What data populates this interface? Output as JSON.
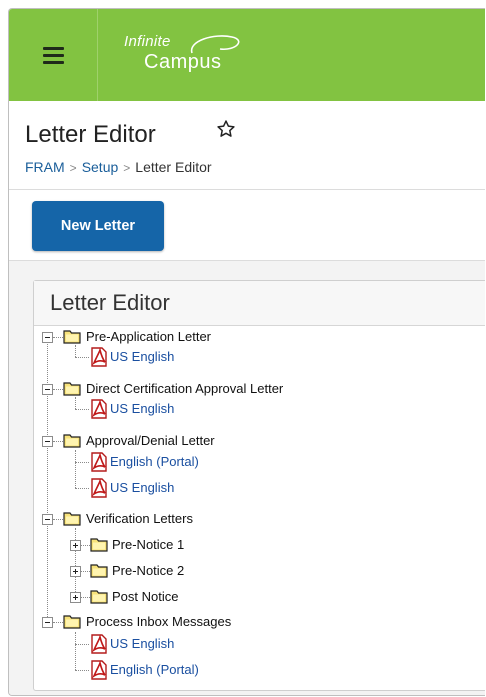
{
  "app": {
    "logo_line1": "Infinite",
    "logo_line2": "Campus",
    "brand_color": "#82c341",
    "primary_button_color": "#1565a8",
    "link_color": "#1a4fa0"
  },
  "page": {
    "title": "Letter Editor",
    "breadcrumb": [
      "FRAM",
      "Setup",
      "Letter Editor"
    ]
  },
  "toolbar": {
    "new_letter_label": "New Letter"
  },
  "panel": {
    "title": "Letter Editor"
  },
  "tree": {
    "pre_application": {
      "label": "Pre-Application Letter",
      "children": [
        "US English"
      ]
    },
    "direct_cert": {
      "label": "Direct Certification Approval Letter",
      "children": [
        "US English"
      ]
    },
    "approval_denial": {
      "label": "Approval/Denial Letter",
      "children": [
        "English (Portal)",
        "US English"
      ]
    },
    "verification": {
      "label": "Verification Letters",
      "children": [
        "Pre-Notice 1",
        "Pre-Notice 2",
        "Post Notice"
      ]
    },
    "process_inbox": {
      "label": "Process Inbox Messages",
      "children": [
        "US English",
        "English (Portal)"
      ]
    }
  }
}
